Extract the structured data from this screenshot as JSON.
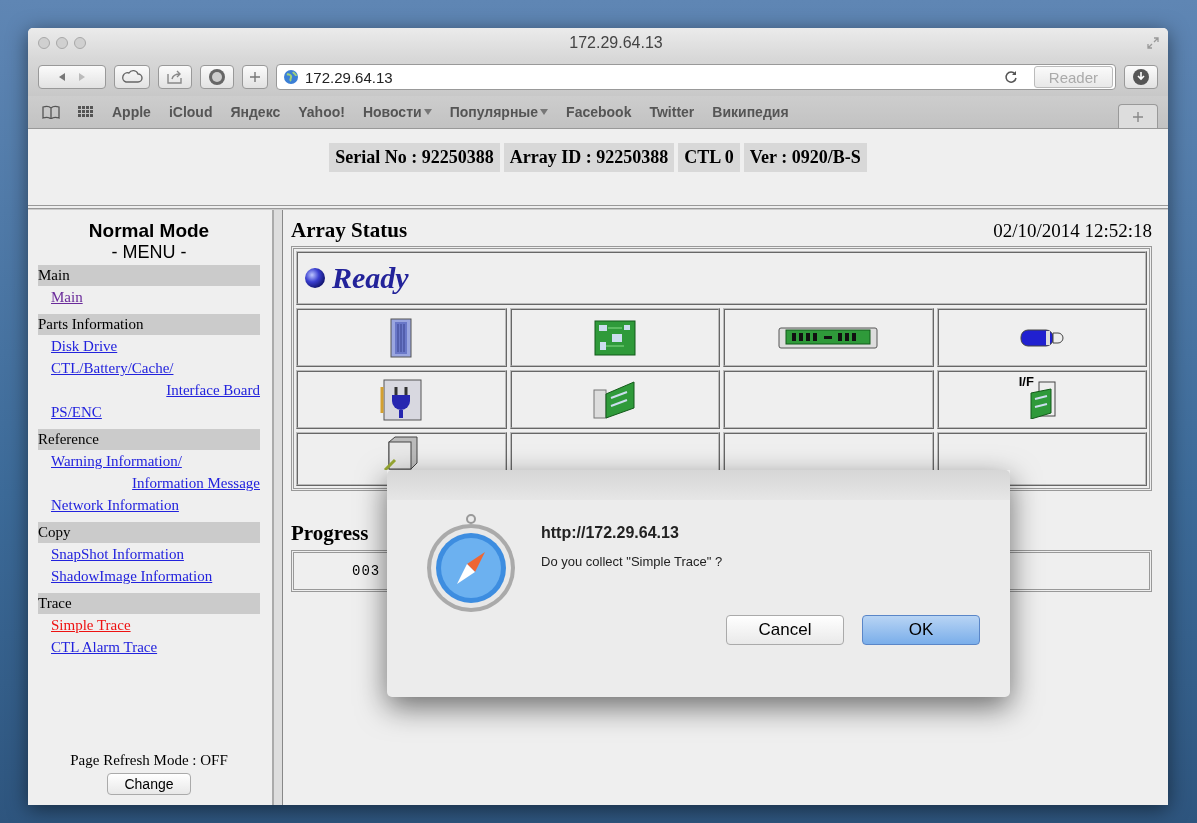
{
  "window": {
    "title": "172.29.64.13"
  },
  "toolbar": {
    "url": "172.29.64.13",
    "reader": "Reader"
  },
  "bookmarks": [
    {
      "label": "Apple",
      "menu": false
    },
    {
      "label": "iCloud",
      "menu": false
    },
    {
      "label": "Яндекс",
      "menu": false
    },
    {
      "label": "Yahoo!",
      "menu": false
    },
    {
      "label": "Новости",
      "menu": true
    },
    {
      "label": "Популярные",
      "menu": true
    },
    {
      "label": "Facebook",
      "menu": false
    },
    {
      "label": "Twitter",
      "menu": false
    },
    {
      "label": "Википедия",
      "menu": false
    }
  ],
  "header": {
    "fields": [
      "Serial No : 92250388",
      "Array ID : 92250388",
      "CTL 0",
      "Ver : 0920/B-S"
    ]
  },
  "menu": {
    "title": "Normal Mode",
    "subtitle": "- MENU -",
    "sections": [
      {
        "heading": "Main",
        "links": [
          {
            "lines": [
              "Main"
            ],
            "visited": true,
            "selected": false
          }
        ]
      },
      {
        "heading": "Parts Information",
        "links": [
          {
            "lines": [
              "Disk Drive"
            ],
            "visited": false,
            "selected": false
          },
          {
            "lines": [
              "CTL/Battery/Cache/",
              "Interface Board"
            ],
            "visited": false,
            "selected": false
          },
          {
            "lines": [
              "PS/ENC"
            ],
            "visited": false,
            "selected": false
          }
        ]
      },
      {
        "heading": "Reference",
        "links": [
          {
            "lines": [
              "Warning Information/",
              "Information Message"
            ],
            "visited": false,
            "selected": false
          },
          {
            "lines": [
              "Network Information"
            ],
            "visited": false,
            "selected": false
          }
        ]
      },
      {
        "heading": "Copy",
        "links": [
          {
            "lines": [
              "SnapShot Information"
            ],
            "visited": false,
            "selected": false
          },
          {
            "lines": [
              "ShadowImage Information"
            ],
            "visited": false,
            "selected": false
          }
        ]
      },
      {
        "heading": "Trace",
        "links": [
          {
            "lines": [
              "Simple Trace"
            ],
            "visited": false,
            "selected": true
          },
          {
            "lines": [
              "CTL Alarm Trace"
            ],
            "visited": false,
            "selected": false
          }
        ]
      }
    ],
    "refresh_label": "Page Refresh Mode : OFF",
    "change_button": "Change"
  },
  "array_status": {
    "title": "Array Status",
    "timestamp": "02/10/2014 12:52:18",
    "status": "Ready",
    "parts": [
      {
        "kind": "disk"
      },
      {
        "kind": "board"
      },
      {
        "kind": "cache"
      },
      {
        "kind": "battery"
      },
      {
        "kind": "power"
      },
      {
        "kind": "card"
      },
      {
        "kind": "empty"
      },
      {
        "kind": "interface",
        "label": "I/F"
      },
      {
        "kind": "fan"
      },
      {
        "kind": "empty"
      },
      {
        "kind": "empty"
      },
      {
        "kind": "empty"
      }
    ]
  },
  "progress": {
    "title": "Progress",
    "value": "003"
  },
  "dialog": {
    "origin": "http://172.29.64.13",
    "message": "Do you collect \"Simple Trace\" ?",
    "buttons": [
      {
        "label": "Cancel",
        "default": false
      },
      {
        "label": "OK",
        "default": true
      }
    ]
  }
}
